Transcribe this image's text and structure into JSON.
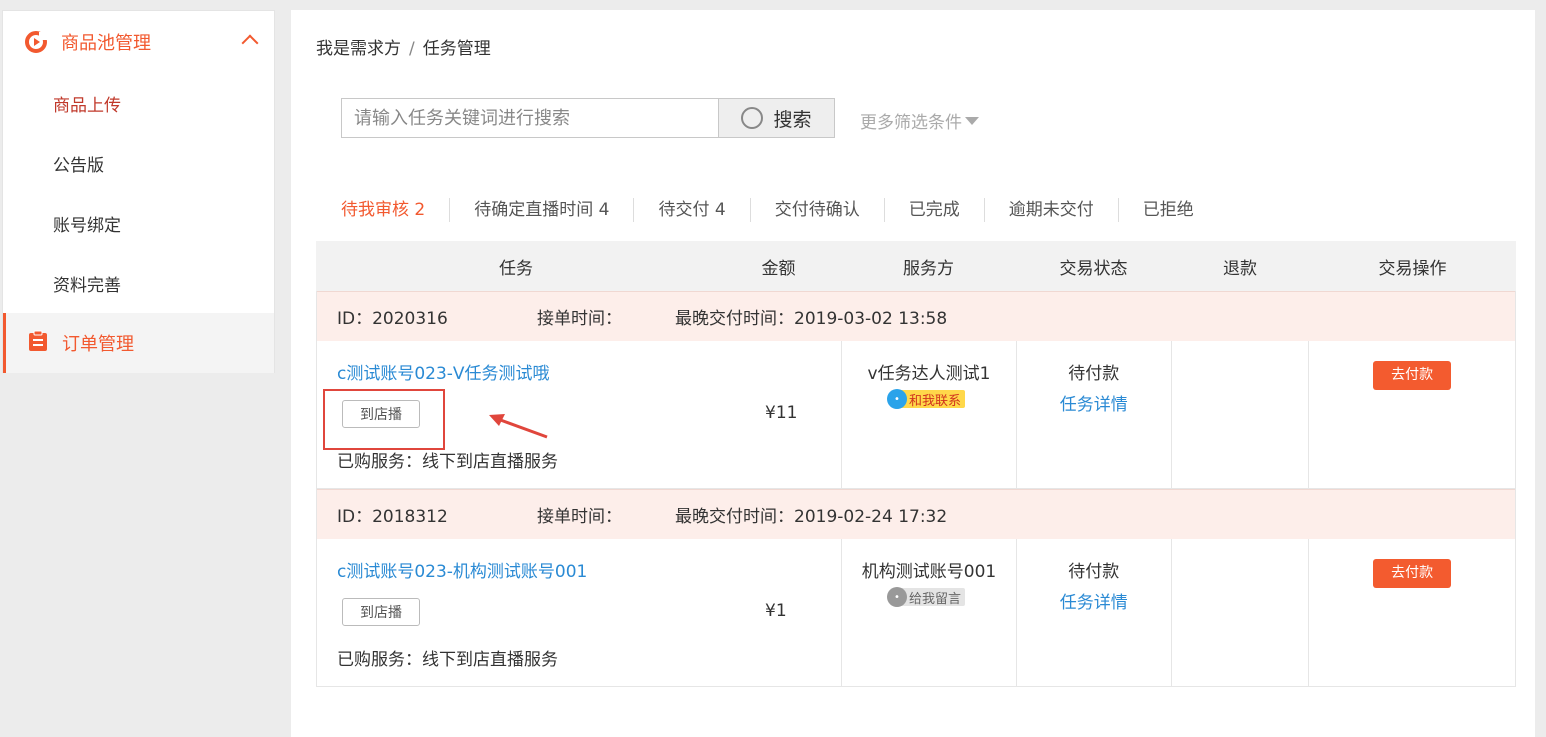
{
  "sidebar": {
    "group_title": "商品池管理",
    "items": [
      {
        "label": "商品上传"
      },
      {
        "label": "公告版"
      },
      {
        "label": "账号绑定"
      },
      {
        "label": "资料完善"
      }
    ],
    "order_title": "订单管理"
  },
  "breadcrumb": {
    "parent": "我是需求方",
    "separator": "/",
    "current": "任务管理"
  },
  "search": {
    "placeholder": "请输入任务关键词进行搜索",
    "button_label": "搜索",
    "more_filter": "更多筛选条件"
  },
  "tabs": [
    {
      "label": "待我审核 2",
      "active": true
    },
    {
      "label": "待确定直播时间 4"
    },
    {
      "label": "待交付 4"
    },
    {
      "label": "交付待确认"
    },
    {
      "label": "已完成"
    },
    {
      "label": "逾期未交付"
    },
    {
      "label": "已拒绝"
    }
  ],
  "table": {
    "headers": [
      "任务",
      "金额",
      "服务方",
      "交易状态",
      "退款",
      "交易操作"
    ],
    "orders": [
      {
        "id": "ID：2020316",
        "accept_time": "接单时间：",
        "deadline": "最晚交付时间：2019-03-02 13:58",
        "task_name": "c测试账号023-V任务测试哦",
        "tag_button": "到店播",
        "bought": "已购服务：线下到店直播服务",
        "amount": "¥11",
        "service_provider": "v任务达人测试1",
        "contact_chip": "和我联系",
        "status": "待付款",
        "detail_link": "任务详情",
        "pay_button": "去付款"
      },
      {
        "id": "ID：2018312",
        "accept_time": "接单时间：",
        "deadline": "最晚交付时间：2019-02-24 17:32",
        "task_name": "c测试账号023-机构测试账号001",
        "tag_button": "到店播",
        "bought": "已购服务：线下到店直播服务",
        "amount": "¥1",
        "service_provider": "机构测试账号001",
        "contact_chip": "给我留言",
        "status": "待付款",
        "detail_link": "任务详情",
        "pay_button": "去付款"
      }
    ]
  },
  "colors": {
    "accent": "#f2592f",
    "link": "#2a8ad4",
    "order_head_bg": "#fdeeea",
    "pay_button": "#f35b2f"
  }
}
